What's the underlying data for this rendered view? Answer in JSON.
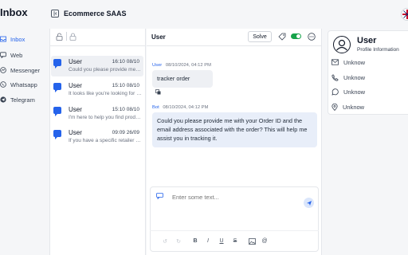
{
  "app": {
    "title": "Inbox",
    "workspace": "Ecommerce SAAS"
  },
  "nav": [
    {
      "label": "Inbox",
      "icon": "inbox-icon",
      "active": true
    },
    {
      "label": "Web",
      "icon": "chat-bubble-icon"
    },
    {
      "label": "Messenger",
      "icon": "messenger-icon"
    },
    {
      "label": "Whatsapp",
      "icon": "whatsapp-icon"
    },
    {
      "label": "Telegram",
      "icon": "telegram-icon"
    }
  ],
  "conversations": [
    {
      "name": "User",
      "time": "16:10 08/10",
      "preview": "Could you please provide me with your Order ID"
    },
    {
      "name": "User",
      "time": "15:10 08/10",
      "preview": "It looks like you're looking for something"
    },
    {
      "name": "User",
      "time": "15:10 08/10",
      "preview": "I'm here to help you find products"
    },
    {
      "name": "User",
      "time": "09:09 26/09",
      "preview": "If you have a specific retailer in mind"
    }
  ],
  "chat": {
    "user": "User",
    "solve_label": "Solve",
    "messages": [
      {
        "sender": "User",
        "timestamp": "08/10/2024, 04:12 PM",
        "text": "tracker order"
      },
      {
        "sender": "Bot",
        "timestamp": "08/10/2024, 04:12 PM",
        "text": "Could you please provide me with your Order ID and the email address associated with the order? This will help me assist you in tracking it."
      }
    ],
    "composer_placeholder": "Enter some text..."
  },
  "profile": {
    "name": "User",
    "subtitle": "Profile Information",
    "fields": [
      {
        "icon": "mail-icon",
        "value": "Unknow"
      },
      {
        "icon": "phone-icon",
        "value": "Unknow"
      },
      {
        "icon": "whatsapp-icon",
        "value": "Unknow"
      },
      {
        "icon": "location-icon",
        "value": "Unknow"
      }
    ]
  },
  "colors": {
    "accent": "#2563eb",
    "toggle_on": "#16a34a",
    "bot_bubble": "#e8eef9",
    "user_bubble": "#eef0f4"
  }
}
